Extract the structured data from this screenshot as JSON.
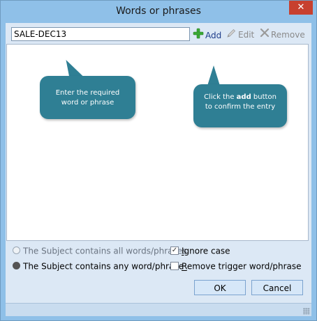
{
  "window": {
    "title": "Words or phrases",
    "close_glyph": "✕"
  },
  "toolbar": {
    "phrase_value": "SALE-DEC13",
    "add_label": "Add",
    "edit_label": "Edit",
    "remove_label": "Remove"
  },
  "callouts": {
    "input_hint_line1": "Enter the required",
    "input_hint_line2": "word or phrase",
    "add_hint_prefix": "Click the ",
    "add_hint_bold": "add",
    "add_hint_suffix": " button",
    "add_hint_line2": "to confirm the entry"
  },
  "options": {
    "match_all_label": "The Subject contains all words/phrases",
    "match_any_label": "The Subject contains any word/phrase",
    "selected": "any",
    "ignore_case_label_u": "I",
    "ignore_case_label_rest": "gnore case",
    "ignore_case_checked": true,
    "remove_trigger_label_u": "R",
    "remove_trigger_label_rest": "emove trigger word/phrase",
    "remove_trigger_checked": false
  },
  "buttons": {
    "ok_label": "OK",
    "cancel_label": "Cancel"
  },
  "colors": {
    "titlebar": "#8fc0e8",
    "client": "#dce8f5",
    "callout": "#2f7f94",
    "close": "#c7402f",
    "add_icon": "#3aa935"
  },
  "icons": {
    "add": "plus-icon",
    "edit": "pencil-icon",
    "remove": "x-icon",
    "close": "close-icon"
  }
}
